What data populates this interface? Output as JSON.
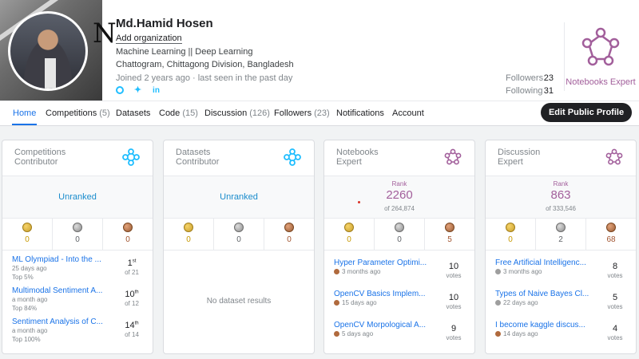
{
  "profile": {
    "name": "Md.Hamid Hosen",
    "add_org": "Add organization",
    "tagline": "Machine Learning || Deep Learning",
    "location": "Chattogram, Chittagong Division, Bangladesh",
    "joined": "Joined 2 years ago · last seen in the past day",
    "cover_letter": "N",
    "social_icons": [
      "github-icon",
      "twitter-icon",
      "linkedin-icon"
    ],
    "followers_label": "Followers",
    "followers_count": "23",
    "following_label": "Following",
    "following_count": "31",
    "badge_label": "Notebooks Expert"
  },
  "tabs": [
    {
      "label": "Home",
      "count": ""
    },
    {
      "label": "Competitions",
      "count": "(5)"
    },
    {
      "label": "Datasets",
      "count": ""
    },
    {
      "label": "Code",
      "count": "(15)"
    },
    {
      "label": "Discussion",
      "count": "(126)"
    },
    {
      "label": "Followers",
      "count": "(23)"
    },
    {
      "label": "Notifications",
      "count": ""
    },
    {
      "label": "Account",
      "count": ""
    }
  ],
  "edit_button": "Edit Public Profile",
  "colors": {
    "accent": "#1a73e8",
    "expert": "#a25f9b",
    "contributor": "#20beff"
  },
  "cards": [
    {
      "title1": "Competitions",
      "title2": "Contributor",
      "rank": "Unranked",
      "medals": {
        "gold": "0",
        "silver": "0",
        "bronze": "0"
      },
      "items": [
        {
          "title": "ML Olympiad - Into the ...",
          "sub1": "25 days ago",
          "sub2": "Top 5%",
          "rank": "1",
          "suffix": "st",
          "of": "of 21"
        },
        {
          "title": "Multimodal Sentiment A...",
          "sub1": "a month ago",
          "sub2": "Top 84%",
          "rank": "10",
          "suffix": "th",
          "of": "of 12"
        },
        {
          "title": "Sentiment Analysis of C...",
          "sub1": "a month ago",
          "sub2": "Top 100%",
          "rank": "14",
          "suffix": "th",
          "of": "of 14"
        }
      ]
    },
    {
      "title1": "Datasets",
      "title2": "Contributor",
      "rank": "Unranked",
      "medals": {
        "gold": "0",
        "silver": "0",
        "bronze": "0"
      },
      "empty": "No dataset results"
    },
    {
      "title1": "Notebooks",
      "title2": "Expert",
      "rank_label": "Rank",
      "rank_value": "2260",
      "rank_of": "of 264,874",
      "medals": {
        "gold": "0",
        "silver": "0",
        "bronze": "5"
      },
      "items": [
        {
          "title": "Hyper Parameter Optimi...",
          "time": "3 months ago",
          "medal": "bronze",
          "votes": "10",
          "votes_label": "votes"
        },
        {
          "title": "OpenCV Basics Implem...",
          "time": "15 days ago",
          "medal": "bronze",
          "votes": "10",
          "votes_label": "votes"
        },
        {
          "title": "OpenCV Morpological A...",
          "time": "5 days ago",
          "medal": "bronze",
          "votes": "9",
          "votes_label": "votes"
        }
      ]
    },
    {
      "title1": "Discussion",
      "title2": "Expert",
      "rank_label": "Rank",
      "rank_value": "863",
      "rank_of": "of 333,546",
      "medals": {
        "gold": "0",
        "silver": "2",
        "bronze": "68"
      },
      "items": [
        {
          "title": "Free Artificial Intelligenc...",
          "time": "3 months ago",
          "medal": "silver",
          "votes": "8",
          "votes_label": "votes"
        },
        {
          "title": "Types of Naive Bayes Cl...",
          "time": "22 days ago",
          "medal": "silver",
          "votes": "5",
          "votes_label": "votes"
        },
        {
          "title": "I become kaggle discus...",
          "time": "14 days ago",
          "medal": "bronze",
          "votes": "4",
          "votes_label": "votes"
        }
      ]
    }
  ]
}
